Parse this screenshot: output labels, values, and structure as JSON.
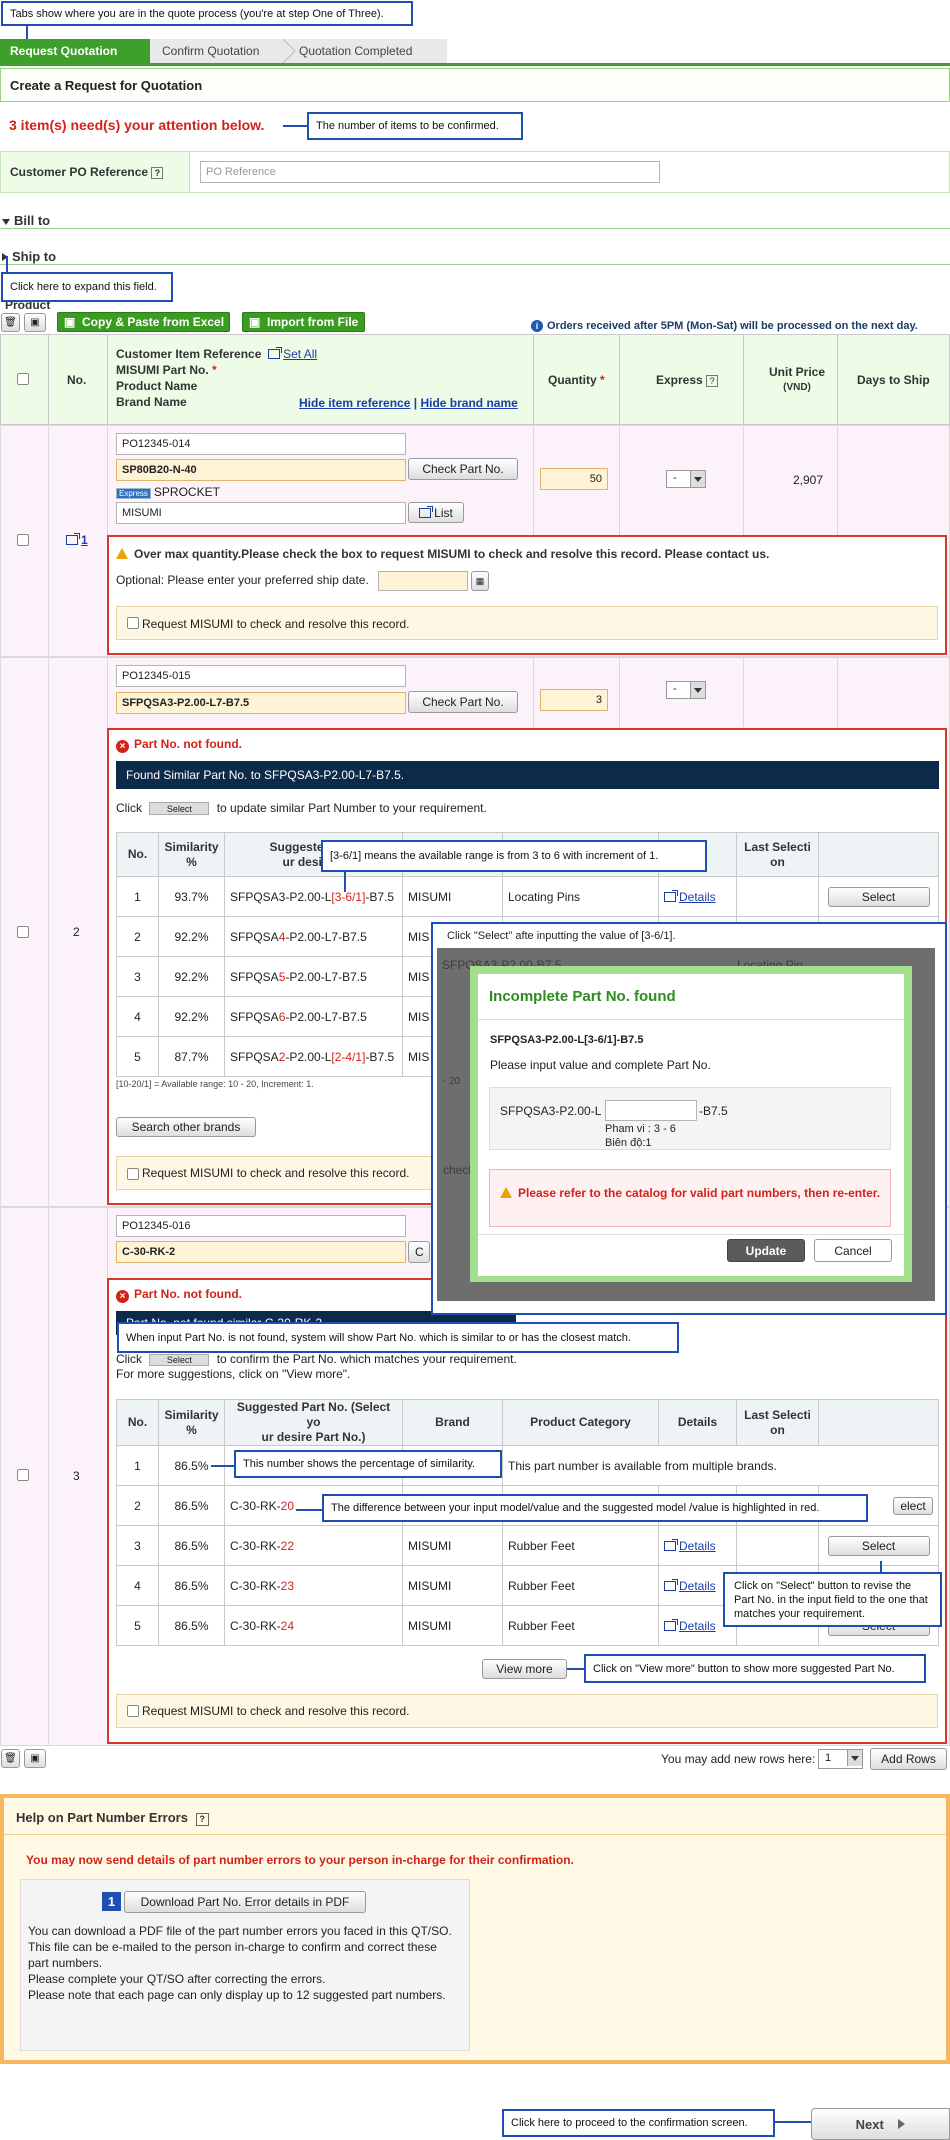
{
  "callouts": {
    "tabs": "Tabs show where you are in the quote process (you're at step One of Three).",
    "items_count": "The number of items to be confirmed.",
    "expand": "Click here to expand this field.",
    "range": "[3-6/1] means the available range is from 3 to 6 with increment of 1.",
    "select_after": "Click \"Select\" afte inputting the value of [3-6/1].",
    "not_found": "When input Part No. is not found, system will show Part No. which is similar to or has the closest match.",
    "similarity": "This number shows the percentage of similarity.",
    "difference": "The difference between your input model/value and the suggested model /value is highlighted in red.",
    "select_revise": "Click on \"Select\" button to revise the Part No. in the input field to the one that matches your requirement.",
    "view_more": "Click on \"View more\" button to show more suggested Part No.",
    "next": "Click here to proceed to the confirmation screen."
  },
  "steps": [
    "Request Quotation",
    "Confirm Quotation",
    "Quotation Completed"
  ],
  "page_title": "Create a Request for Quotation",
  "attention": "3 item(s) need(s) your attention below.",
  "customer_po": {
    "label": "Customer PO Reference",
    "help": "?",
    "placeholder": "PO Reference"
  },
  "bill_to": "Bill to",
  "ship_to": "Ship to",
  "product_label": "Product",
  "toolbar": {
    "copy_paste": "Copy & Paste from Excel",
    "import": "Import from File",
    "notice": "Orders received after 5PM (Mon-Sat) will be processed on the next day.",
    "info_icon": "i"
  },
  "table_header": {
    "no": "No.",
    "item_ref": "Customer Item Reference",
    "set_all": "Set All",
    "part_no": "MISUMI Part No.",
    "product_name": "Product Name",
    "brand_name": "Brand Name",
    "hide_item": "Hide item reference",
    "sep": "|",
    "hide_brand": "Hide brand name",
    "quantity": "Quantity",
    "express": "Express",
    "unit_price": "Unit Price",
    "vnd": "(VND)",
    "days": "Days to Ship",
    "req": "*",
    "help": "?"
  },
  "row1": {
    "no": "1",
    "ref": "PO12345-014",
    "part": "SP80B20-N-40",
    "check": "Check Part No.",
    "express_tag": "Express",
    "product": "SPROCKET",
    "brand": "MISUMI",
    "list": "List",
    "qty": "50",
    "express_val": "-",
    "price": "2,907",
    "warn": "Over max quantity.Please check the box to request MISUMI to check and resolve this record. Please contact us.",
    "optional": "Optional: Please enter your preferred ship date.",
    "request": "Request MISUMI to check and resolve this record."
  },
  "row2": {
    "no": "2",
    "ref": "PO12345-015",
    "part": "SFPQSA3-P2.00-L7-B7.5",
    "check": "Check Part No.",
    "qty": "3",
    "express_val": "-",
    "err": "Part No. not found.",
    "found_similar": "Found Similar Part No. to SFPQSA3-P2.00-L7-B7.5.",
    "click": "Click",
    "select_small": "Select",
    "click_rest": "to update similar Part Number to your requirement.",
    "cols": {
      "no": "No.",
      "sim1": "Similarity",
      "sim2": "%",
      "sug1": "Suggested Part",
      "sug2": "ur desire P",
      "last1": "Last Selecti",
      "last2": "on"
    },
    "rows": [
      {
        "no": "1",
        "sim": "93.7%",
        "pre": "SFPQSA3-P2.00-L",
        "hl": "[3-6/1]",
        "post": "-B7.5",
        "brand": "MISUMI",
        "cat": "Locating Pins",
        "details": "Details",
        "select": "Select"
      },
      {
        "no": "2",
        "sim": "92.2%",
        "pre": "SFPQSA",
        "hl": "4",
        "post": "-P2.00-L7-B7.5",
        "brand": "MIS"
      },
      {
        "no": "3",
        "sim": "92.2%",
        "pre": "SFPQSA",
        "hl": "5",
        "post": "-P2.00-L7-B7.5",
        "brand": "MIS"
      },
      {
        "no": "4",
        "sim": "92.2%",
        "pre": "SFPQSA",
        "hl": "6",
        "post": "-P2.00-L7-B7.5",
        "brand": "MIS"
      },
      {
        "no": "5",
        "sim": "87.7%",
        "pre": "SFPQSA",
        "hl": "2",
        "post": "-P2.00-L",
        "hl2": "[2-4/1]",
        "post2": "-B7.5",
        "brand": "MIS"
      }
    ],
    "range_note": "[10-20/1] = Available range: 10 - 20, Increment: 1.",
    "search_other": "Search other brands",
    "request": "Request MISUMI to check and resolve this record."
  },
  "modal": {
    "title": "Incomplete Part No. found",
    "part": "SFPQSA3-P2.00-L[3-6/1]-B7.5",
    "instruction": "Please input value and complete Part No.",
    "prefix": "SFPQSA3-P2.00-L",
    "suffix": "-B7.5",
    "range": "Pham vi : 3 - 6",
    "step": "Biên độ:1",
    "warn": "Please refer to the catalog for valid part numbers, then re-enter.",
    "update": "Update",
    "cancel": "Cancel",
    "bg_snip1": "SFPQSA3-P2.00-B7.5",
    "bg_snip2": "Locating Pin",
    "bg_snip3": "- 20",
    "bg_snip4": "check"
  },
  "row3": {
    "no": "3",
    "ref": "PO12345-016",
    "part": "C-30-RK-2",
    "check": "C",
    "err": "Part No. not found.",
    "bg_bar": "Part No. not found similar C-30-RK-2",
    "click": "Click",
    "select_small": "Select",
    "click_rest": "to confirm the Part No. which matches your requirement.",
    "more": "For more suggestions, click on \"View more\".",
    "cols": {
      "no": "No.",
      "sim1": "Similarity",
      "sim2": "%",
      "sug1": "Suggested Part No. (Select yo",
      "sug2": "ur desire Part No.)",
      "brand": "Brand",
      "cat": "Product Category",
      "details": "Details",
      "last1": "Last Selecti",
      "last2": "on"
    },
    "multi": "This part number is available from multiple brands.",
    "rows": [
      {
        "no": "1",
        "sim": "86.5%"
      },
      {
        "no": "2",
        "sim": "86.5%",
        "pre": "C-30-RK-",
        "hl": "20",
        "select": "elect"
      },
      {
        "no": "3",
        "sim": "86.5%",
        "pre": "C-30-RK-",
        "hl": "22",
        "brand": "MISUMI",
        "cat": "Rubber Feet",
        "details": "Details",
        "select": "Select"
      },
      {
        "no": "4",
        "sim": "86.5%",
        "pre": "C-30-RK-",
        "hl": "23",
        "brand": "MISUMI",
        "cat": "Rubber Feet",
        "details": "Details"
      },
      {
        "no": "5",
        "sim": "86.5%",
        "pre": "C-30-RK-",
        "hl": "24",
        "brand": "MISUMI",
        "cat": "Rubber Feet",
        "details": "Details",
        "select": "Select"
      }
    ],
    "view_more": "View more",
    "request": "Request MISUMI to check and resolve this record."
  },
  "add_rows": {
    "label": "You may add new rows here:",
    "count": "1",
    "button": "Add Rows"
  },
  "help": {
    "title": "Help on Part Number Errors",
    "help": "?",
    "notice": "You may now send details of part number errors to your person in-charge for their confirmation.",
    "badge": "1",
    "download": "Download Part No. Error details in PDF",
    "lines": [
      "You can download a PDF file of the part number errors you faced in this QT/SO.",
      "This file can be e-mailed to the person in-charge to confirm and correct these",
      "part numbers.",
      "Please complete your QT/SO after correcting the errors.",
      "Please note that each page can only display up to 12 suggested part numbers."
    ]
  },
  "next": "Next"
}
